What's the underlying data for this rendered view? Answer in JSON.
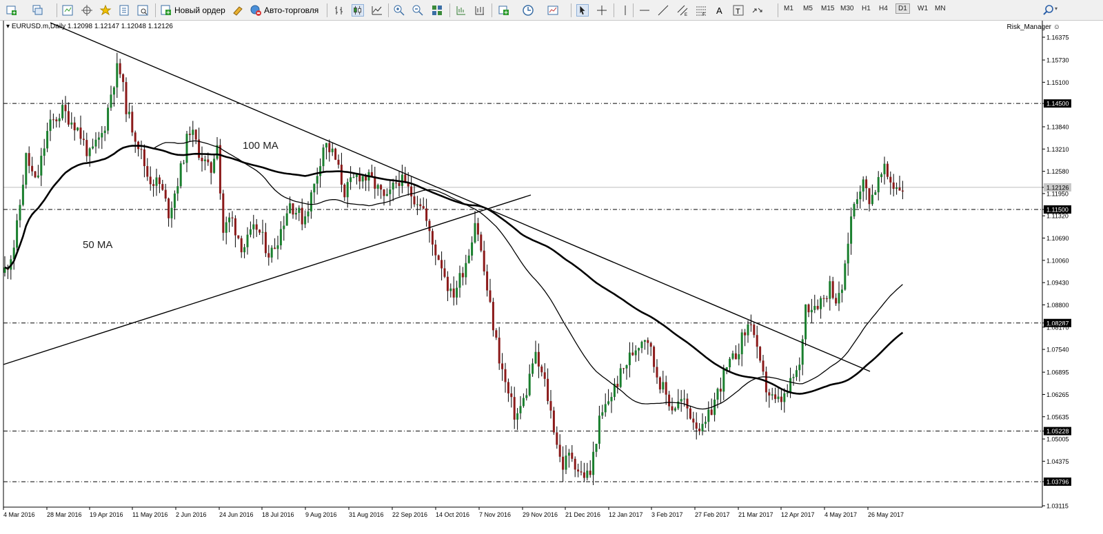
{
  "toolbar": {
    "new_order": "Новый ордер",
    "auto_trading": "Авто-торговля",
    "timeframes": [
      "M1",
      "M5",
      "M15",
      "M30",
      "H1",
      "H4",
      "D1",
      "W1",
      "MN"
    ],
    "active_timeframe": "D1",
    "icons": [
      "new-chart-icon",
      "profiles-icon",
      "market-watch-icon",
      "navigator-icon",
      "favorites-icon",
      "data-window-icon",
      "terminal-icon",
      "new-order-icon",
      "metaeditor-icon",
      "auto-trading-icon",
      "bar-chart-icon",
      "candlestick-icon",
      "line-chart-icon",
      "zoom-in-icon",
      "zoom-out-icon",
      "tile-windows-icon",
      "auto-scroll-icon",
      "chart-shift-icon",
      "indicators-icon",
      "periods-icon",
      "templates-icon",
      "cursor-icon",
      "crosshair-icon",
      "vertical-line-icon",
      "horizontal-line-icon",
      "trendline-icon",
      "equidistant-channel-icon",
      "fibonacci-icon",
      "text-icon",
      "text-label-icon",
      "arrows-icon",
      "search-icon"
    ]
  },
  "chart": {
    "title": "EURUSD.m,Daily  1.12098 1.12147 1.12048 1.12126",
    "expert": "Risk_Manager",
    "annotations": {
      "ma100": "100 MA",
      "ma50": "50 MA"
    },
    "current_price": "1.12126",
    "colors": {
      "bull": "#1a7f2e",
      "bear": "#8b1a1a",
      "line": "#000000",
      "current_label_bg": "#c8c8c8"
    }
  },
  "chart_data": {
    "type": "candlestick",
    "symbol": "EURUSD.m",
    "timeframe": "Daily",
    "ohlc_header": {
      "open": 1.12098,
      "high": 1.12147,
      "low": 1.12048,
      "close": 1.12126
    },
    "ylim": [
      1.03115,
      1.16375
    ],
    "y_ticks": [
      "1.16375",
      "1.15730",
      "1.15100",
      "1.14500",
      "1.13840",
      "1.13210",
      "1.12580",
      "1.12126",
      "1.11950",
      "1.11500",
      "1.11320",
      "1.10690",
      "1.10060",
      "1.09430",
      "1.08800",
      "1.08287",
      "1.08170",
      "1.07540",
      "1.06895",
      "1.06265",
      "1.05635",
      "1.05228",
      "1.05005",
      "1.04375",
      "1.03796",
      "1.03115"
    ],
    "x_ticks": [
      "4 Mar 2016",
      "28 Mar 2016",
      "19 Apr 2016",
      "11 May 2016",
      "2 Jun 2016",
      "24 Jun 2016",
      "18 Jul 2016",
      "9 Aug 2016",
      "31 Aug 2016",
      "22 Sep 2016",
      "14 Oct 2016",
      "7 Nov 2016",
      "29 Nov 2016",
      "21 Dec 2016",
      "12 Jan 2017",
      "3 Feb 2017",
      "27 Feb 2017",
      "21 Mar 2017",
      "12 Apr 2017",
      "4 May 2017",
      "26 May 2017"
    ],
    "horizontal_levels": [
      "1.14500",
      "1.11500",
      "1.08287",
      "1.05228",
      "1.03796"
    ],
    "indicators": [
      "100 MA",
      "50 MA"
    ],
    "trendlines": [
      "descending resistance",
      "ascending support"
    ],
    "price_path": [
      [
        0,
        1.095
      ],
      [
        12,
        1.1
      ],
      [
        22,
        1.106
      ],
      [
        38,
        1.13
      ],
      [
        52,
        1.122
      ],
      [
        70,
        1.138
      ],
      [
        90,
        1.143
      ],
      [
        110,
        1.139
      ],
      [
        130,
        1.13
      ],
      [
        150,
        1.137
      ],
      [
        163,
        1.15
      ],
      [
        172,
        1.156
      ],
      [
        185,
        1.142
      ],
      [
        200,
        1.134
      ],
      [
        215,
        1.124
      ],
      [
        232,
        1.122
      ],
      [
        245,
        1.114
      ],
      [
        262,
        1.126
      ],
      [
        275,
        1.138
      ],
      [
        290,
        1.131
      ],
      [
        305,
        1.125
      ],
      [
        316,
        1.136
      ],
      [
        322,
        1.108
      ],
      [
        335,
        1.113
      ],
      [
        352,
        1.104
      ],
      [
        372,
        1.11
      ],
      [
        392,
        1.102
      ],
      [
        405,
        1.108
      ],
      [
        420,
        1.117
      ],
      [
        440,
        1.112
      ],
      [
        455,
        1.121
      ],
      [
        470,
        1.134
      ],
      [
        485,
        1.13
      ],
      [
        500,
        1.12
      ],
      [
        520,
        1.125
      ],
      [
        540,
        1.123
      ],
      [
        560,
        1.117
      ],
      [
        578,
        1.124
      ],
      [
        598,
        1.119
      ],
      [
        612,
        1.117
      ],
      [
        625,
        1.106
      ],
      [
        640,
        1.1
      ],
      [
        655,
        1.09
      ],
      [
        668,
        1.096
      ],
      [
        680,
        1.103
      ],
      [
        690,
        1.113
      ],
      [
        700,
        1.1
      ],
      [
        712,
        1.086
      ],
      [
        722,
        1.075
      ],
      [
        735,
        1.064
      ],
      [
        748,
        1.056
      ],
      [
        762,
        1.062
      ],
      [
        775,
        1.074
      ],
      [
        790,
        1.066
      ],
      [
        805,
        1.052
      ],
      [
        815,
        1.042
      ],
      [
        828,
        1.046
      ],
      [
        842,
        1.04
      ],
      [
        856,
        1.04
      ],
      [
        868,
        1.054
      ],
      [
        880,
        1.06
      ],
      [
        895,
        1.066
      ],
      [
        910,
        1.072
      ],
      [
        925,
        1.077
      ],
      [
        938,
        1.08
      ],
      [
        950,
        1.07
      ],
      [
        962,
        1.064
      ],
      [
        975,
        1.059
      ],
      [
        990,
        1.061
      ],
      [
        1005,
        1.056
      ],
      [
        1020,
        1.052
      ],
      [
        1035,
        1.06
      ],
      [
        1050,
        1.068
      ],
      [
        1065,
        1.073
      ],
      [
        1078,
        1.079
      ],
      [
        1090,
        1.084
      ],
      [
        1100,
        1.072
      ],
      [
        1112,
        1.064
      ],
      [
        1125,
        1.06
      ],
      [
        1140,
        1.062
      ],
      [
        1152,
        1.068
      ],
      [
        1160,
        1.07
      ],
      [
        1168,
        1.088
      ],
      [
        1180,
        1.088
      ],
      [
        1195,
        1.09
      ],
      [
        1205,
        1.094
      ],
      [
        1215,
        1.088
      ],
      [
        1225,
        1.096
      ],
      [
        1232,
        1.11
      ],
      [
        1240,
        1.118
      ],
      [
        1250,
        1.123
      ],
      [
        1262,
        1.118
      ],
      [
        1272,
        1.122
      ],
      [
        1282,
        1.126
      ],
      [
        1295,
        1.122
      ],
      [
        1310,
        1.1212
      ]
    ]
  }
}
